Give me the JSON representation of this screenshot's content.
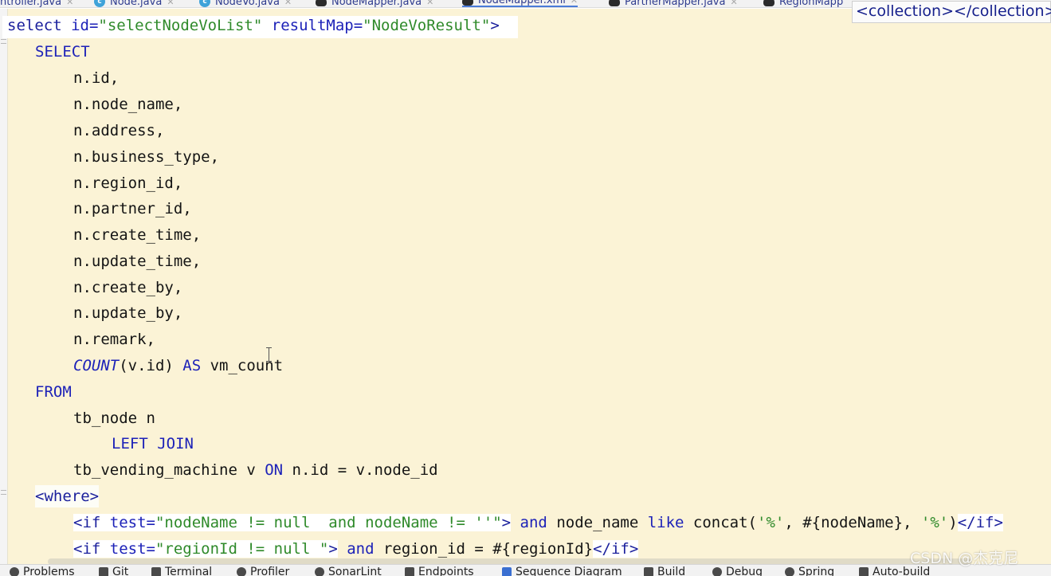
{
  "tabs": [
    {
      "label": "ntroller.java",
      "icon": "none"
    },
    {
      "label": "Node.java",
      "icon": "class-icon"
    },
    {
      "label": "NodeVo.java",
      "icon": "class-icon"
    },
    {
      "label": "NodeMapper.java",
      "icon": "mybatis-bird-icon"
    },
    {
      "label": "NodeMapper.xml",
      "icon": "mybatis-bird-icon",
      "active": true
    },
    {
      "label": "PartnerMapper.java",
      "icon": "mybatis-bird-icon"
    },
    {
      "label": "RegionMapp",
      "icon": "mybatis-bird-icon"
    }
  ],
  "tooltip": "<collection></collection>",
  "code": {
    "l1": {
      "p1": "select ",
      "p2": "id=",
      "p3": "\"selectNodeVoList\"",
      "p4": " resultMap=",
      "p5": "\"NodeVoResult\"",
      "p6": ">"
    },
    "l2": "SELECT",
    "l3": "n.id,",
    "l4": "n.node_name,",
    "l5": "n.address,",
    "l6": "n.business_type,",
    "l7": "n.region_id,",
    "l8": "n.partner_id,",
    "l9": "n.create_time,",
    "l10": "n.update_time,",
    "l11": "n.create_by,",
    "l12": "n.update_by,",
    "l13": "n.remark,",
    "l14": {
      "fn": "COUNT",
      "p1": "(v.id) ",
      "kw": "AS",
      "p2": " vm_count"
    },
    "l15": "FROM",
    "l16": "tb_node n",
    "l17": "LEFT JOIN",
    "l18": {
      "p1": "tb_vending_machine v ",
      "kw": "ON",
      "p2": " n.id = v.node_id"
    },
    "l19": "<where>",
    "l20": {
      "t1": "<if ",
      "a1": "test=",
      "s1": "\"nodeName != null  and nodeName != ''\"",
      "t2": ">",
      "k1": " and",
      "p1": " node_name ",
      "k2": "like",
      "p2": " concat(",
      "s2": "'%'",
      "p3": ", #{nodeName}, ",
      "s3": "'%'",
      "p4": ")",
      "t3": "</if>"
    },
    "l21": {
      "t1": "<if ",
      "a1": "test=",
      "s1": "\"regionId != null \"",
      "t2": ">",
      "k1": " and",
      "p1": " region_id = #{regionId}",
      "t3": "</if>"
    }
  },
  "toolbar": [
    {
      "label": "Problems",
      "icon": "problems-icon"
    },
    {
      "label": "Git",
      "icon": "git-icon"
    },
    {
      "label": "Terminal",
      "icon": "terminal-icon"
    },
    {
      "label": "Profiler",
      "icon": "profiler-icon"
    },
    {
      "label": "SonarLint",
      "icon": "sonarlint-icon"
    },
    {
      "label": "Endpoints",
      "icon": "endpoints-icon"
    },
    {
      "label": "Sequence Diagram",
      "icon": "sequence-diagram-icon"
    },
    {
      "label": "Build",
      "icon": "build-icon"
    },
    {
      "label": "Debug",
      "icon": "debug-icon"
    },
    {
      "label": "Spring",
      "icon": "spring-icon"
    },
    {
      "label": "Auto-build",
      "icon": "auto-build-icon"
    }
  ],
  "watermark": "CSDN @杰克尼"
}
